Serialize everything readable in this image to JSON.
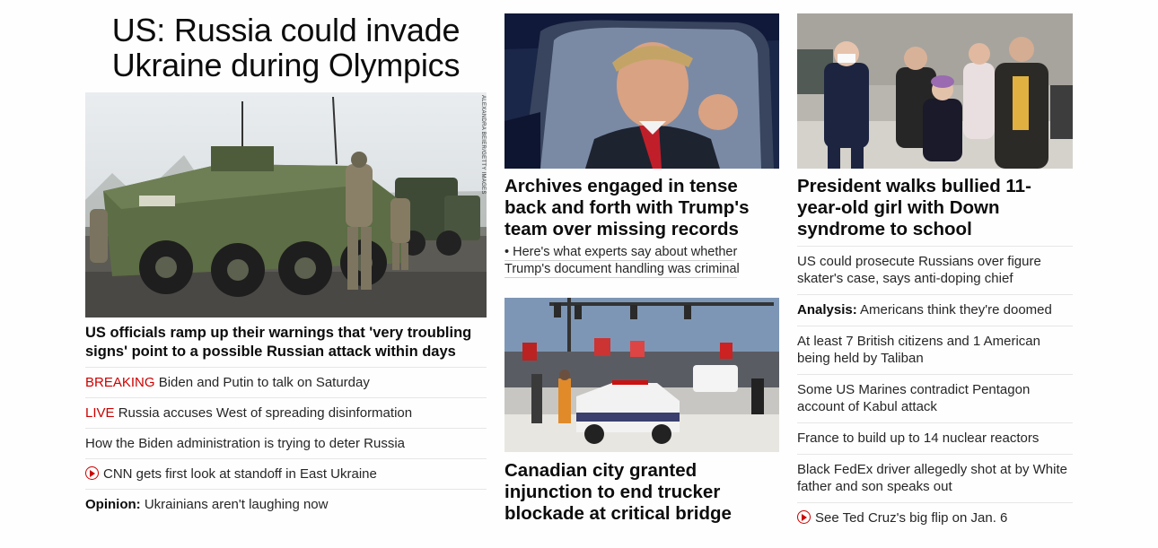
{
  "column1": {
    "headline": "US: Russia could invade Ukraine during Olympics",
    "photo_credit": "ALEXANDRA BEIER/GETTY IMAGES",
    "lead": "US officials ramp up their warnings that 'very troubling signs' point to a possible Russian attack within days",
    "items": [
      {
        "tag": "BREAKING",
        "text": "Biden and Putin to talk on Saturday"
      },
      {
        "tag": "LIVE",
        "text": "Russia accuses West of spreading disinformation"
      },
      {
        "text": "How the Biden administration is trying to deter Russia"
      },
      {
        "icon": "play-icon",
        "text": "CNN gets first look at standoff in East Ukraine"
      },
      {
        "label": "Opinion:",
        "text": "Ukrainians aren't laughing now"
      }
    ]
  },
  "column2": {
    "story1": {
      "headline": "Archives engaged in tense back and forth with Trump's team over missing records",
      "sub": "• Here's what experts say about whether Trump's document handling was criminal"
    },
    "story2": {
      "headline": "Canadian city granted injunction to end trucker blockade at critical bridge"
    }
  },
  "column3": {
    "headline": "President walks bullied 11-year-old girl with Down syndrome to school",
    "items": [
      {
        "text": "US could prosecute Russians over figure skater's case, says anti-doping chief"
      },
      {
        "label": "Analysis:",
        "text": "Americans think they're doomed"
      },
      {
        "text": "At least 7 British citizens and 1 American being held by Taliban"
      },
      {
        "text": "Some US Marines contradict Pentagon account of Kabul attack"
      },
      {
        "text": "France to build up to 14 nuclear reactors"
      },
      {
        "text": "Black FedEx driver allegedly shot at by White father and son speaks out"
      },
      {
        "icon": "play-icon",
        "text": "See Ted Cruz's big flip on Jan. 6"
      }
    ]
  },
  "colors": {
    "accent_red": "#cc0000",
    "text": "#0c0c0c",
    "divider": "#e6e6e6"
  }
}
